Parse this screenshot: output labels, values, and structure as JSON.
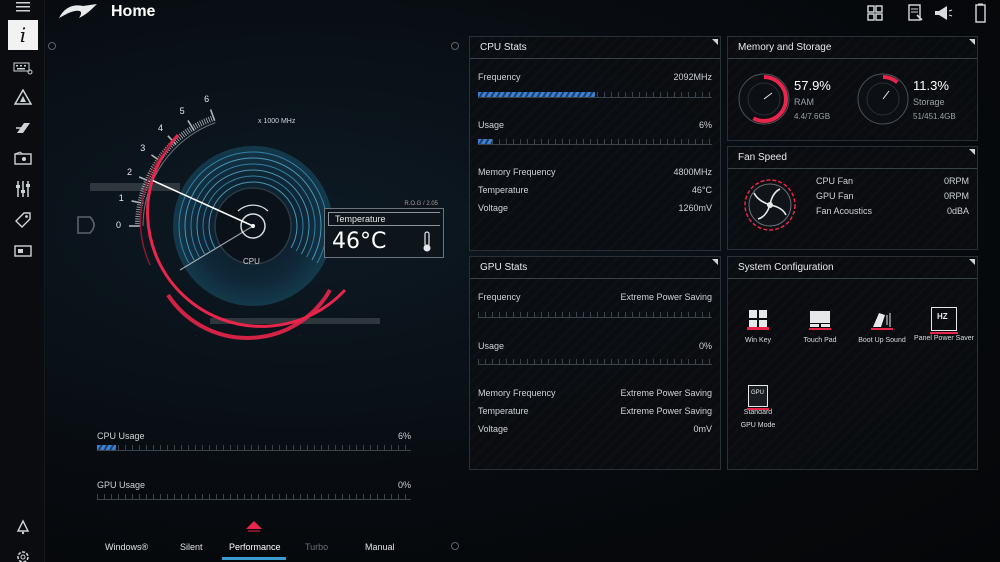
{
  "header": {
    "title": "Home"
  },
  "colors": {
    "accent_red": "#e8254a",
    "accent_blue": "#3d7fd1",
    "text": "#e6e8ea"
  },
  "sidebar": {
    "items": [
      {
        "icon": "info-icon",
        "glyph": "i"
      },
      {
        "icon": "keyboard-icon"
      },
      {
        "icon": "aura-icon"
      },
      {
        "icon": "armoury-icon"
      },
      {
        "icon": "game-library-icon"
      },
      {
        "icon": "scenario-profiles-icon"
      },
      {
        "icon": "deals-icon"
      },
      {
        "icon": "monitor-icon"
      }
    ],
    "bottom": [
      {
        "icon": "user-center-icon"
      },
      {
        "icon": "settings-icon"
      }
    ]
  },
  "gauge": {
    "scale_label": "x 1000 MHz",
    "ticks": [
      "0",
      "1",
      "2",
      "3",
      "4",
      "5",
      "6"
    ],
    "center_label": "CPU",
    "frequency_ghz": 2.092,
    "temp_label": "Temperature",
    "temp_value": "46°C",
    "badge": "R.O.G / 2.05"
  },
  "cpu_stats": {
    "title": "CPU Stats",
    "frequency_label": "Frequency",
    "frequency_value": "2092MHz",
    "frequency_fraction": 0.5,
    "usage_label": "Usage",
    "usage_value": "6%",
    "usage_fraction": 0.06,
    "mem_freq_label": "Memory Frequency",
    "mem_freq_value": "4800MHz",
    "temp_label": "Temperature",
    "temp_value": "46°C",
    "voltage_label": "Voltage",
    "voltage_value": "1260mV"
  },
  "gpu_stats": {
    "title": "GPU Stats",
    "frequency_label": "Frequency",
    "frequency_value": "Extreme Power Saving",
    "usage_label": "Usage",
    "usage_value": "0%",
    "mem_freq_label": "Memory Frequency",
    "mem_freq_value": "Extreme Power Saving",
    "temp_label": "Temperature",
    "temp_value": "Extreme Power Saving",
    "voltage_label": "Voltage",
    "voltage_value": "0mV"
  },
  "memory": {
    "title": "Memory and Storage",
    "ram_pct": "57.9%",
    "ram_label": "RAM",
    "ram_detail": "4.4/7.6GB",
    "ram_fraction": 0.579,
    "storage_pct": "11.3%",
    "storage_label": "Storage",
    "storage_detail": "51/451.4GB",
    "storage_fraction": 0.113
  },
  "fan": {
    "title": "Fan Speed",
    "cpu_fan_label": "CPU Fan",
    "cpu_fan_value": "0RPM",
    "gpu_fan_label": "GPU Fan",
    "gpu_fan_value": "0RPM",
    "acoustics_label": "Fan Acoustics",
    "acoustics_value": "0dBA"
  },
  "sysconfig": {
    "title": "System Configuration",
    "items": [
      {
        "label": "Win Key",
        "icon": "windows-key-icon"
      },
      {
        "label": "Touch Pad",
        "icon": "touchpad-icon"
      },
      {
        "label": "Boot Up Sound",
        "icon": "boot-sound-icon"
      },
      {
        "label": "Panel Power Saver",
        "icon": "panel-hz-icon",
        "glyph": "HZ"
      },
      {
        "label": "GPU Mode",
        "sub": "Standard",
        "icon": "gpu-mode-icon",
        "glyph": "GPU"
      }
    ]
  },
  "bottom": {
    "cpu_usage_label": "CPU Usage",
    "cpu_usage_value": "6%",
    "cpu_usage_fraction": 0.06,
    "gpu_usage_label": "GPU Usage",
    "gpu_usage_value": "0%"
  },
  "modes": [
    {
      "label": "Windows®",
      "state": "normal"
    },
    {
      "label": "Silent",
      "state": "normal"
    },
    {
      "label": "Performance",
      "state": "active"
    },
    {
      "label": "Turbo",
      "state": "dim"
    },
    {
      "label": "Manual",
      "state": "normal"
    }
  ]
}
